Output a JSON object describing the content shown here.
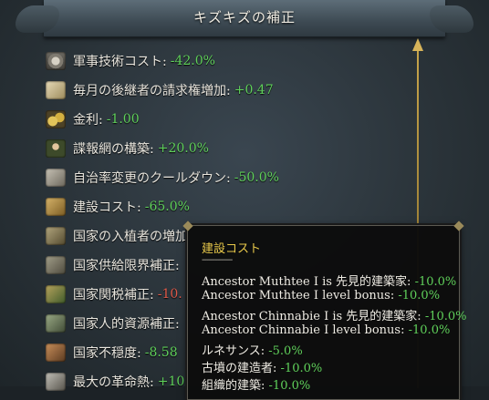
{
  "header": {
    "title": "キズキズの補正"
  },
  "rows": [
    {
      "icon": "gear-icon",
      "label": "軍事技術コスト:",
      "value": "-42.0%",
      "tone": "pos"
    },
    {
      "icon": "scroll-icon",
      "label": "毎月の後継者の請求権増加:",
      "value": "+0.47",
      "tone": "pos"
    },
    {
      "icon": "coins-icon",
      "label": "金利:",
      "value": "-1.00",
      "tone": "pos"
    },
    {
      "icon": "spy-icon",
      "label": "諜報網の構築:",
      "value": "+20.0%",
      "tone": "pos"
    },
    {
      "icon": "timer-icon",
      "label": "自治率変更のクールダウン:",
      "value": "-50.0%",
      "tone": "pos"
    },
    {
      "icon": "building-icon",
      "label": "建設コスト:",
      "value": "-65.0%",
      "tone": "pos"
    },
    {
      "icon": "colonists-icon",
      "label": "国家の入植者の増加",
      "value": "",
      "tone": "pos"
    },
    {
      "icon": "supply-icon",
      "label": "国家供給限界補正:",
      "value": "",
      "tone": "pos"
    },
    {
      "icon": "tariff-icon",
      "label": "国家関税補正:",
      "value": "-10.",
      "tone": "neg"
    },
    {
      "icon": "manpower-icon",
      "label": "国家人的資源補正:",
      "value": "",
      "tone": "pos"
    },
    {
      "icon": "unrest-icon",
      "label": "国家不穏度:",
      "value": "-8.58",
      "tone": "pos"
    },
    {
      "icon": "revolution-icon",
      "label": "最大の革命熱:",
      "value": "+10.",
      "tone": "pos"
    }
  ],
  "tooltip": {
    "title": "建設コスト",
    "separator": "--------------",
    "lines": [
      {
        "label": "Ancestor Muthtee I is 先見的建築家:",
        "value": "-10.0%"
      },
      {
        "label": "Ancestor Muthtee I level bonus:",
        "value": "-10.0%"
      },
      {
        "label": "Ancestor Chinnabie I is 先見的建築家:",
        "value": "-10.0%"
      },
      {
        "label": "Ancestor Chinnabie I level bonus:",
        "value": "-10.0%"
      },
      {
        "label": "ルネサンス:",
        "value": "-5.0%"
      },
      {
        "label": "古墳の建造者:",
        "value": "-10.0%"
      },
      {
        "label": "組織的建築:",
        "value": "-10.0%"
      }
    ]
  },
  "colors": {
    "positive": "#5fd05a",
    "negative": "#e05a4a",
    "tooltip_title": "#e8c84a"
  }
}
